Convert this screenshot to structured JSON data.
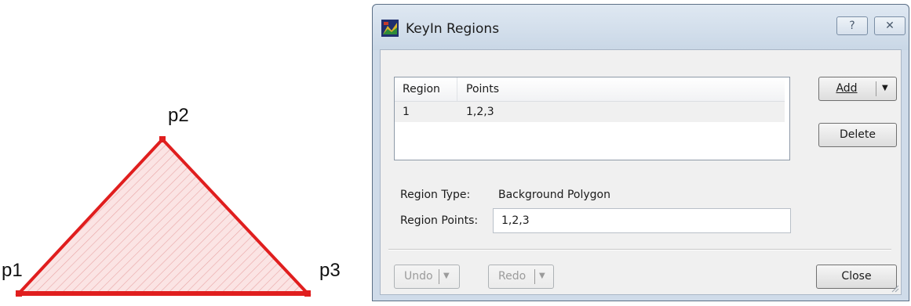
{
  "diagram": {
    "points": [
      {
        "label": "p1"
      },
      {
        "label": "p2"
      },
      {
        "label": "p3"
      }
    ]
  },
  "dialog": {
    "title": "KeyIn Regions",
    "help_glyph": "?",
    "close_glyph": "✕",
    "table": {
      "columns": [
        "Region",
        "Points"
      ],
      "rows": [
        {
          "region": "1",
          "points": "1,2,3"
        }
      ]
    },
    "buttons": {
      "add": "Add",
      "delete": "Delete",
      "undo": "Undo",
      "redo": "Redo",
      "close": "Close"
    },
    "region_type_label": "Region Type:",
    "region_type_value": "Background Polygon",
    "region_points_label": "Region Points:",
    "region_points_value": "1,2,3"
  },
  "colors": {
    "triangle_stroke": "#e01e1e",
    "triangle_fill": "#fbe4e4",
    "hatch": "#e9a6a6"
  }
}
